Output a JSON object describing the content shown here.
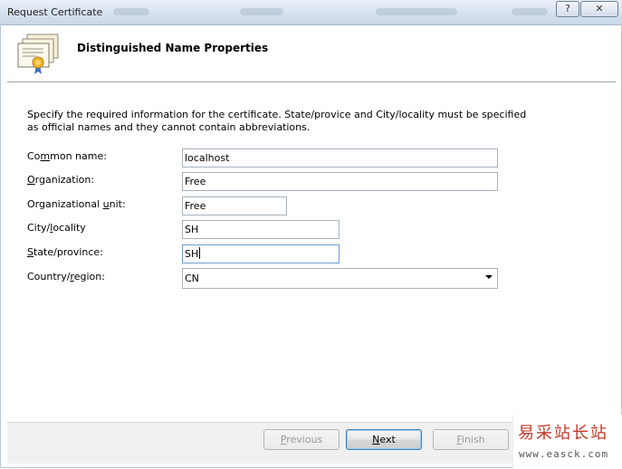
{
  "window": {
    "title": "Request Certificate",
    "help_label": "?",
    "close_label": "✕"
  },
  "header": {
    "title": "Distinguished Name Properties",
    "icon": "certificate-icon"
  },
  "description": "Specify the required information for the certificate. State/provice and City/locality must be specified as official names and they cannot contain abbreviations.",
  "fields": {
    "common_name": {
      "label_pre": "Co",
      "label_key": "m",
      "label_post": "mon name:",
      "value": "localhost"
    },
    "organization": {
      "label_pre": "",
      "label_key": "O",
      "label_post": "rganization:",
      "value": "Free"
    },
    "org_unit": {
      "label_pre": "Organizational ",
      "label_key": "u",
      "label_post": "nit:",
      "value": "Free"
    },
    "city": {
      "label_pre": "City/",
      "label_key": "l",
      "label_post": "ocality",
      "value": "SH"
    },
    "state": {
      "label_pre": "",
      "label_key": "S",
      "label_post": "tate/province:",
      "value": "SH"
    },
    "country": {
      "label_pre": "Country/",
      "label_key": "r",
      "label_post": "egion:",
      "value": "CN"
    }
  },
  "buttons": {
    "previous": {
      "pre": "",
      "key": "P",
      "post": "revious"
    },
    "next": {
      "pre": "",
      "key": "N",
      "post": "ext"
    },
    "finish": {
      "pre": "",
      "key": "F",
      "post": "inish"
    }
  },
  "watermark": {
    "chinese": "易采站长站",
    "url": "www.easck.com"
  },
  "colors": {
    "titlebar": "#d9e4f1",
    "button_bar": "#f0f0f0",
    "watermark_red": "#c43a28"
  }
}
